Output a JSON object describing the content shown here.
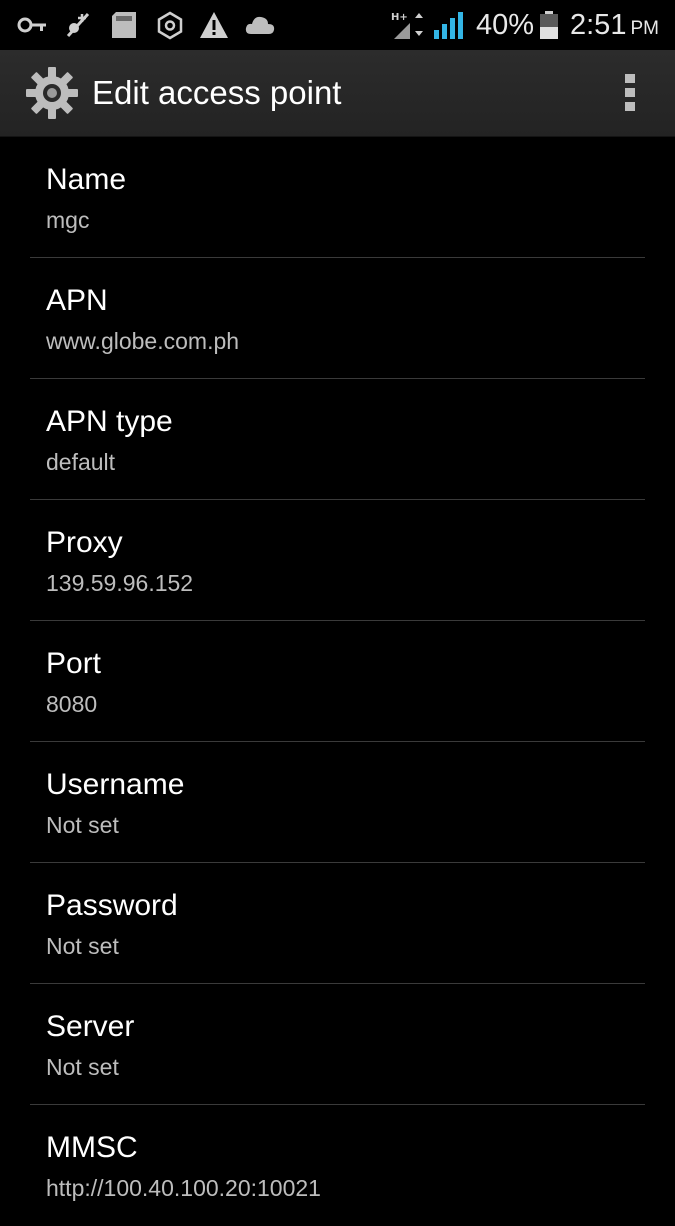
{
  "status_bar": {
    "icons": [
      "key-icon",
      "usb-debug-icon",
      "sd-card-icon",
      "sync-icon",
      "warning-icon",
      "cloud-icon",
      "data-hplus-icon",
      "signal-icon",
      "battery-icon"
    ],
    "network_label": "H+",
    "battery_percent": "40%",
    "time": "2:51",
    "ampm": "PM",
    "accent_color": "#33b5e5"
  },
  "action_bar": {
    "title": "Edit access point",
    "icon": "settings-gear-icon",
    "overflow_icon": "overflow-menu-icon"
  },
  "settings": [
    {
      "title": "Name",
      "summary": "mgc"
    },
    {
      "title": "APN",
      "summary": "www.globe.com.ph"
    },
    {
      "title": "APN type",
      "summary": "default"
    },
    {
      "title": "Proxy",
      "summary": "139.59.96.152"
    },
    {
      "title": "Port",
      "summary": "8080"
    },
    {
      "title": "Username",
      "summary": "Not set"
    },
    {
      "title": "Password",
      "summary": "Not set"
    },
    {
      "title": "Server",
      "summary": "Not set"
    },
    {
      "title": "MMSC",
      "summary": "http://100.40.100.20:10021"
    }
  ]
}
